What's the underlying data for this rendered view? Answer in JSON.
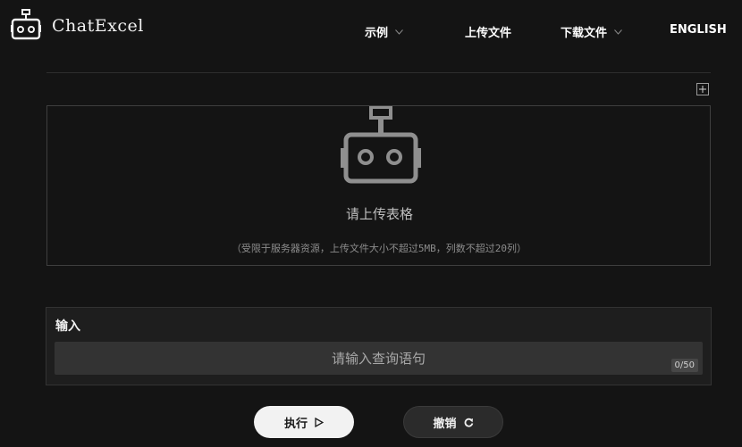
{
  "header": {
    "brand": "ChatExcel",
    "nav": {
      "examples": "示例",
      "upload": "上传文件",
      "download": "下载文件",
      "language": "ENGLISH"
    }
  },
  "upload": {
    "add_icon": "plus-square-icon",
    "prompt": "请上传表格",
    "hint": "（受限于服务器资源，上传文件大小不超过5MB，列数不超过20列）"
  },
  "input_panel": {
    "label": "输入",
    "placeholder": "请输入查询语句",
    "value": "",
    "char_count": "0/50"
  },
  "actions": {
    "run_label": "执行",
    "run_icon": "play-outline-icon",
    "cancel_label": "撤销",
    "cancel_icon": "undo-icon"
  },
  "colors": {
    "background": "#141414",
    "panel": "#1e1e1e",
    "input_bg": "#333333",
    "primary_button": "#f2f2f2"
  }
}
